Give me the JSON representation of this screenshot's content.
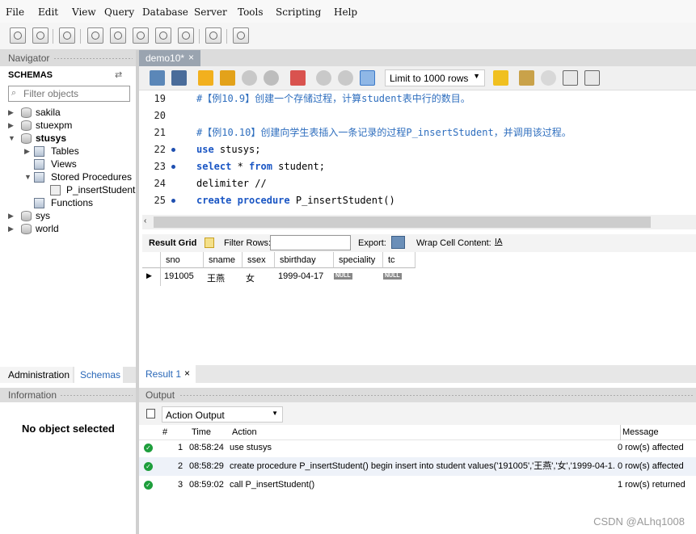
{
  "menu": [
    "File",
    "Edit",
    "View",
    "Query",
    "Database",
    "Server",
    "Tools",
    "Scripting",
    "Help"
  ],
  "navigator": {
    "title": "Navigator",
    "schemas_label": "SCHEMAS",
    "filter_placeholder": "Filter objects",
    "tree": {
      "sakila": "sakila",
      "stuexpm": "stuexpm",
      "stusys": "stusys",
      "tables": "Tables",
      "views": "Views",
      "stored_procedures": "Stored Procedures",
      "p_insertstudent": "P_insertStudent",
      "functions": "Functions",
      "sys": "sys",
      "world": "world"
    }
  },
  "left_tabs": {
    "administration": "Administration",
    "schemas": "Schemas"
  },
  "information": {
    "title": "Information",
    "empty": "No object selected"
  },
  "doc_tab": {
    "label": "demo10*",
    "close": "×"
  },
  "sql_toolbar": {
    "limit_label": "Limit to 1000 rows"
  },
  "editor": {
    "lines": [
      {
        "n": "19",
        "text": "#【例10.9】创建一个存储过程，计算student表中行的数目。"
      },
      {
        "n": "20",
        "text": ""
      },
      {
        "n": "21",
        "text": "#【例10.10】创建向学生表插入一条记录的过程P_insertStudent，并调用该过程。"
      },
      {
        "n": "22",
        "kw1": "use",
        "rest1": " stusys;"
      },
      {
        "n": "23",
        "kw1": "select",
        "rest1": " * ",
        "kw2": "from",
        "rest2": " student;"
      },
      {
        "n": "24",
        "text": "delimiter //"
      },
      {
        "n": "25",
        "kw1": "create",
        "rest1": " ",
        "kw2": "procedure",
        "rest2": " P_insertStudent()"
      }
    ]
  },
  "result_toolbar": {
    "result_grid": "Result Grid",
    "filter_rows": "Filter Rows:",
    "export": "Export:",
    "wrap": "Wrap Cell Content:"
  },
  "grid": {
    "columns": [
      "sno",
      "sname",
      "ssex",
      "sbirthday",
      "speciality",
      "tc"
    ],
    "row": {
      "sno": "191005",
      "sname": "王燕",
      "ssex": "女",
      "sbirthday": "1999-04-17",
      "speciality": "NULL",
      "tc": "NULL"
    }
  },
  "result_tab": {
    "label": "Result 1",
    "close": "×"
  },
  "output": {
    "title": "Output",
    "mode": "Action Output",
    "headers": {
      "num": "#",
      "time": "Time",
      "action": "Action",
      "message": "Message"
    },
    "rows": [
      {
        "num": "1",
        "time": "08:58:24",
        "action": "use stusys",
        "message": "0 row(s) affected"
      },
      {
        "num": "2",
        "time": "08:58:29",
        "action": "create procedure P_insertStudent() begin insert into student values('191005','王燕','女','1999-04-1...",
        "message": "0 row(s) affected"
      },
      {
        "num": "3",
        "time": "08:59:02",
        "action": "call P_insertStudent()",
        "message": "1 row(s) returned"
      }
    ]
  },
  "watermark": "CSDN @ALhq1008",
  "colors": {
    "accent": "#1a56c4",
    "success": "#1e9e3c",
    "tab_active": "#9aa4b0"
  }
}
